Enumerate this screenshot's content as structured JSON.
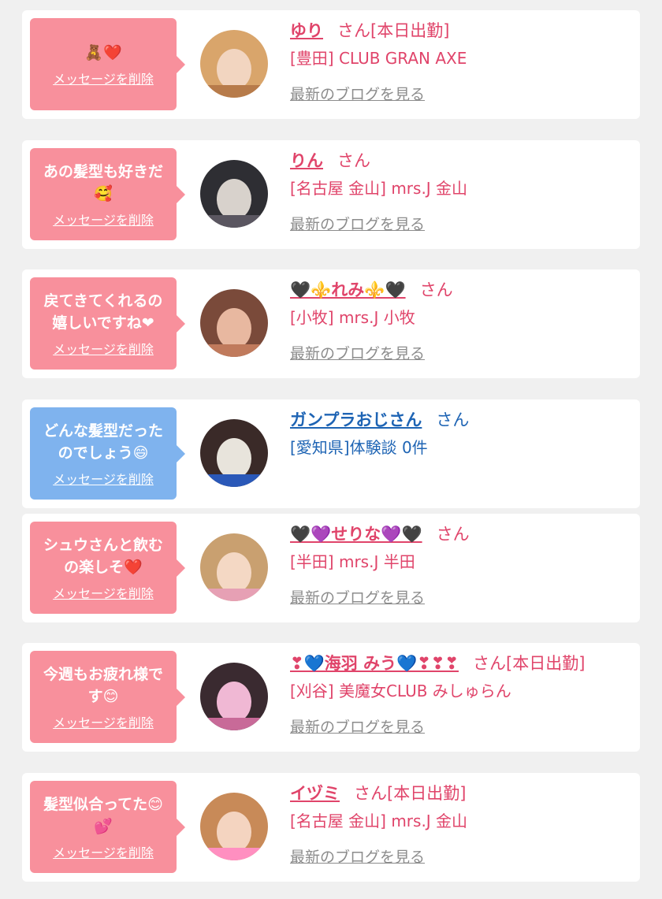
{
  "items": [
    {
      "bubble_color": "pink",
      "message": "🧸❤️",
      "delete_label": "メッセージを削除",
      "name": "ゆり",
      "name_color": "pink",
      "suffix": "さん[本日出勤]",
      "shop": "[豊田] CLUB GRAN AXE",
      "blog_label": "最新のブログを見る",
      "avatar_colors": [
        "#d9a56b",
        "#f2d5c0",
        "#b77b4a"
      ]
    },
    {
      "bubble_color": "pink",
      "message": "あの髪型も好きだ\n🥰",
      "delete_label": "メッセージを削除",
      "name": "りん",
      "name_color": "pink",
      "suffix": "さん",
      "shop": "[名古屋 金山] mrs.J 金山",
      "blog_label": "最新のブログを見る",
      "avatar_colors": [
        "#2e2e33",
        "#d8d2cc",
        "#5a5660"
      ]
    },
    {
      "bubble_color": "pink",
      "message": "戻てきてくれるの\n嬉しいですね❤",
      "delete_label": "メッセージを削除",
      "name": "🖤⚜️れみ⚜️🖤",
      "name_color": "pink",
      "suffix": "さん",
      "shop": "[小牧] mrs.J 小牧",
      "blog_label": "最新のブログを見る",
      "avatar_colors": [
        "#7a4a3a",
        "#e8b8a0",
        "#c07a5c"
      ]
    },
    {
      "bubble_color": "blue",
      "message": "どんな髪型だった\nのでしょう😄",
      "delete_label": "メッセージを削除",
      "name": "ガンプラおじさん",
      "name_color": "blue",
      "suffix": "さん",
      "shop": "[愛知県]体験談 0件",
      "blog_label": "",
      "avatar_colors": [
        "#3a2a28",
        "#e8e4dc",
        "#2a58b8"
      ]
    },
    {
      "bubble_color": "pink",
      "message": "シュウさんと飲む\nの楽しそ❤️",
      "delete_label": "メッセージを削除",
      "name": "🖤💜せりな💜🖤",
      "name_color": "pink",
      "suffix": "さん",
      "shop": "[半田] mrs.J 半田",
      "blog_label": "最新のブログを見る",
      "avatar_colors": [
        "#c9a070",
        "#f4d8c4",
        "#e6a0b4"
      ]
    },
    {
      "bubble_color": "pink",
      "message": "今週もお疲れ様で\nす😊",
      "delete_label": "メッセージを削除",
      "name": "❣💙海羽 みう💙❣❣❣",
      "name_color": "pink",
      "suffix": "さん[本日出勤]",
      "shop": "[刈谷] 美魔女CLUB みしゅらん",
      "blog_label": "最新のブログを見る",
      "avatar_colors": [
        "#3a2a30",
        "#f0b8d4",
        "#c86a98"
      ]
    },
    {
      "bubble_color": "pink",
      "message": "髪型似合ってた😊\n💕",
      "delete_label": "メッセージを削除",
      "name": "イヅミ",
      "name_color": "pink",
      "suffix": "さん[本日出勤]",
      "shop": "[名古屋 金山] mrs.J 金山",
      "blog_label": "最新のブログを見る",
      "avatar_colors": [
        "#c88a58",
        "#f4d4c0",
        "#ff8fc0"
      ]
    }
  ]
}
